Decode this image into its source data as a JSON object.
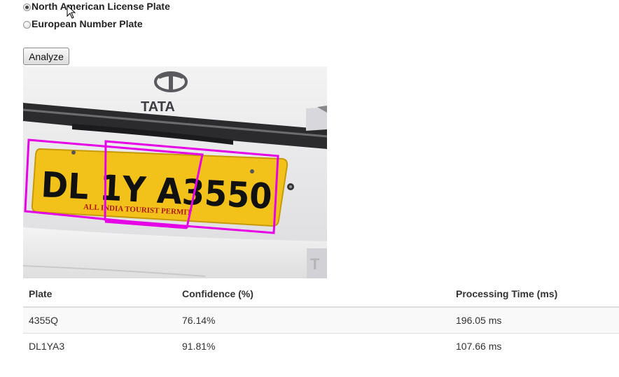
{
  "options": {
    "radio_north_american": {
      "label": "North American License Plate",
      "checked": true
    },
    "radio_european": {
      "label": "European Number Plate",
      "checked": false
    }
  },
  "analyze_button": "Analyze",
  "photo": {
    "brand_text": "TATA",
    "plate_text": "DL 1Y A3550",
    "plate_subtext": "ALL INDIA TOURIST PERMIT",
    "detection_box_color": "#e600e6",
    "plate_color": "#f2c21a"
  },
  "results": {
    "headers": [
      "Plate",
      "Confidence (%)",
      "Processing Time (ms)"
    ],
    "rows": [
      [
        "4355Q",
        "76.14%",
        "196.05 ms"
      ],
      [
        "DL1YA3",
        "91.81%",
        "107.66 ms"
      ]
    ]
  }
}
